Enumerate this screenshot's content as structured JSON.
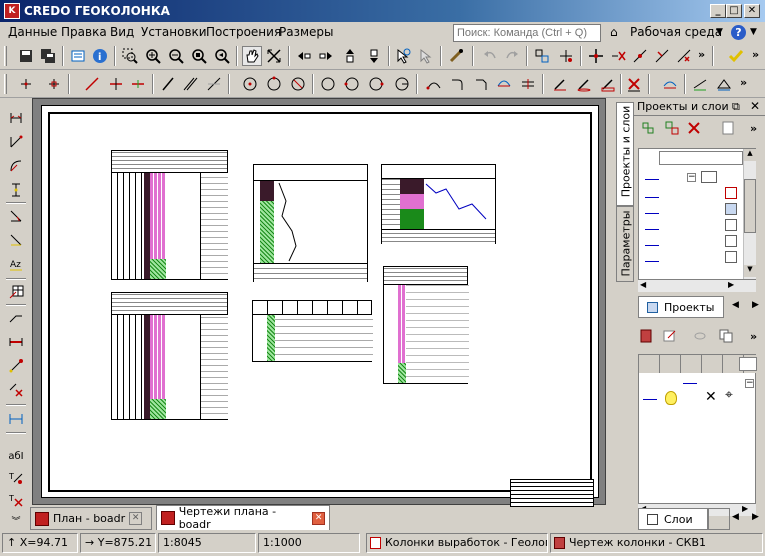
{
  "app": {
    "title": "CREDO ГЕОКОЛОНКА",
    "logo_text": "K"
  },
  "window_buttons": {
    "minimize": "_",
    "maximize": "□",
    "close": "✕"
  },
  "menu": [
    "Данные",
    "Правка",
    "Вид",
    "Установки",
    "Построения",
    "Размеры"
  ],
  "command": {
    "placeholder": "Поиск: Команда (Ctrl + Q)"
  },
  "workspace_label": "Рабочая среда",
  "help_symbol": "?",
  "right_panel": {
    "title": "Проекты и слои",
    "vertical_tabs": [
      "Проекты и слои",
      "Параметры"
    ],
    "tab_projects": "Проекты",
    "tab_layers": "Слои"
  },
  "doc_tabs": [
    {
      "label": "План - boadr",
      "active": false
    },
    {
      "label": "Чертежи плана - boadr",
      "active": true
    }
  ],
  "status": {
    "x": "X=94.71",
    "y": "Y=875.21",
    "scale1": "1:8045",
    "scale2": "1:1000",
    "layer": "Колонки выработок - Геология",
    "drawing": "Чертеж колонки - СКВ1"
  },
  "left_labels": {
    "az": "Az",
    "abi": "абI"
  },
  "colors": {
    "title_start": "#0a246a",
    "title_end": "#a6caf0",
    "hatch": "#1a8a1a",
    "pink": "#e070d0",
    "dark": "#3a1a2a"
  }
}
